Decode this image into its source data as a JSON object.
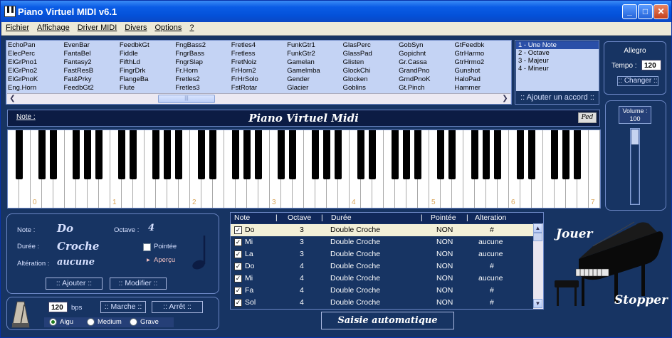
{
  "window": {
    "title": "Piano Virtuel MIDI v6.1"
  },
  "menu": [
    "Fichier",
    "Affichage",
    "Driver MIDI",
    "Divers",
    "Options",
    "?"
  ],
  "instruments": [
    [
      "EchoPan",
      "ElecPerc",
      "ElGrPno1",
      "ElGrPno2",
      "ElGrPnoK",
      "Eng.Horn"
    ],
    [
      "EvenBar",
      "FantaBel",
      "Fantasy2",
      "FastResB",
      "Fat&Prky",
      "FeedbGt2"
    ],
    [
      "FeedbkGt",
      "Fiddle",
      "FifthLd",
      "FingrDrk",
      "FlangeBa",
      "Flute"
    ],
    [
      "FngBass2",
      "FngrBass",
      "FngrSlap",
      "Fr.Horn",
      "Fretles2",
      "Fretles3"
    ],
    [
      "Fretles4",
      "Fretless",
      "FretNoiz",
      "FrHorn2",
      "FrHrSolo",
      "FstRotar"
    ],
    [
      "FunkGtr1",
      "FunkGtr2",
      "Gamelan",
      "Gamelmba",
      "Gender",
      "Glacier"
    ],
    [
      "GlasPerc",
      "GlassPad",
      "Glisten",
      "GlockChi",
      "Glocken",
      "Goblins"
    ],
    [
      "GobSyn",
      "Gopichnt",
      "Gr.Cassa",
      "GrandPno",
      "GrndPnoK",
      "Gt.Pinch"
    ],
    [
      "GtFeedbk",
      "GtrHarmo",
      "GtrHrmo2",
      "Gunshot",
      "HaloPad",
      "Hammer"
    ]
  ],
  "chords": {
    "items": [
      "1 - Une Note",
      "2 - Octave",
      "3 - Majeur",
      "4 - Mineur"
    ],
    "add_label": ":: Ajouter un accord ::"
  },
  "tempo": {
    "label": "Allegro",
    "tempo_label": "Tempo :",
    "value": "120",
    "change_label": ":: Changer ::"
  },
  "keyboard": {
    "note_label": "Note :",
    "title": "Piano Virtuel Midi",
    "pedal_label": "Ped",
    "octaves": [
      "0",
      "1",
      "2",
      "3",
      "4",
      "5",
      "6",
      "7"
    ]
  },
  "volume": {
    "label": "Volume :",
    "value": "100",
    "level": 0.8
  },
  "note_panel": {
    "note_label": "Note :",
    "note_value": "Do",
    "octave_label": "Octave :",
    "octave_value": "4",
    "duration_label": "Durée :",
    "duration_value": "Croche",
    "dotted_label": "Pointée",
    "alteration_label": "Altération :",
    "alteration_value": "aucune",
    "preview_label": "Aperçu",
    "add_label": ":: Ajouter ::",
    "modify_label": ":: Modifier ::"
  },
  "metronome": {
    "bps_value": "120",
    "bps_label": "bps",
    "start_label": ":: Marche ::",
    "stop_label": ":: Arrêt ::",
    "sounds": [
      "Aigu",
      "Medium",
      "Grave"
    ]
  },
  "table": {
    "headers": [
      "Note",
      "Octave",
      "Durée",
      "Pointée",
      "Alteration"
    ],
    "rows": [
      [
        "Do",
        "3",
        "Double Croche",
        "NON",
        "#"
      ],
      [
        "Mi",
        "3",
        "Double Croche",
        "NON",
        "aucune"
      ],
      [
        "La",
        "3",
        "Double Croche",
        "NON",
        "aucune"
      ],
      [
        "Do",
        "4",
        "Double Croche",
        "NON",
        "#"
      ],
      [
        "Mi",
        "4",
        "Double Croche",
        "NON",
        "aucune"
      ],
      [
        "Fa",
        "4",
        "Double Croche",
        "NON",
        "#"
      ],
      [
        "Sol",
        "4",
        "Double Croche",
        "NON",
        "#"
      ]
    ]
  },
  "auto_label": "Saisie automatique",
  "play_label": "Jouer",
  "stop_label": "Stopper"
}
